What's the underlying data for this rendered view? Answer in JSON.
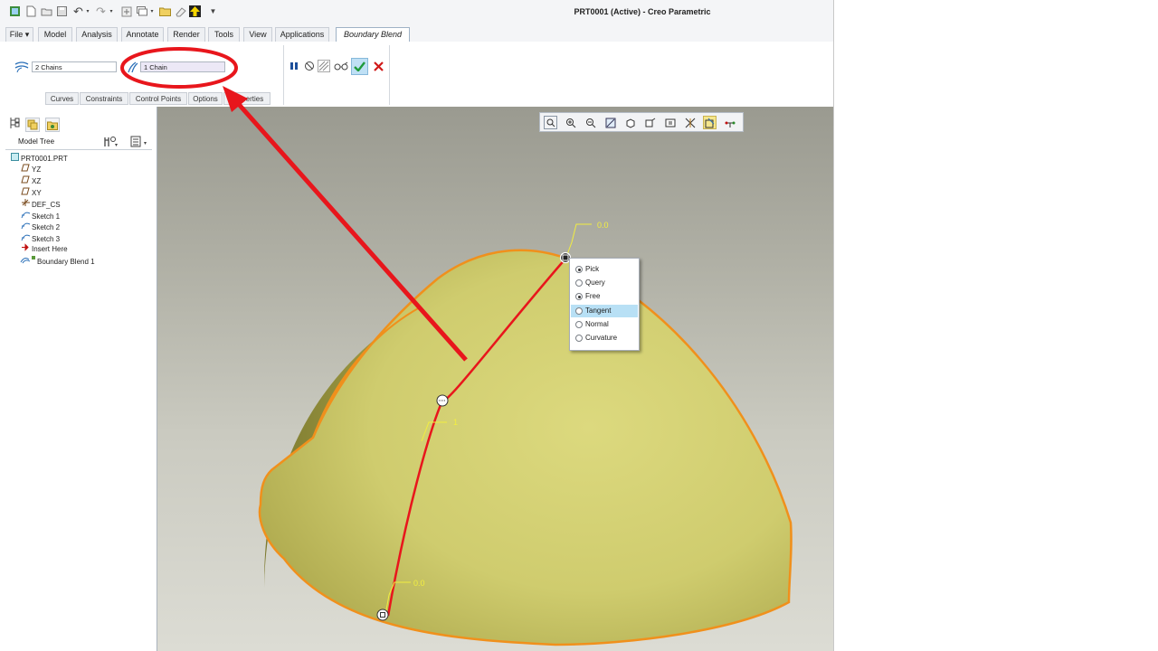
{
  "window": {
    "title": "PRT0001 (Active) - Creo Parametric"
  },
  "quick_access": {
    "icons": [
      "app-icon",
      "new-icon",
      "open-icon",
      "save-icon",
      "undo-icon",
      "undo-dropdown-icon",
      "redo-icon",
      "redo-dropdown-icon",
      "regenerate-icon",
      "windows-icon",
      "windows-dropdown-icon",
      "folder-icon",
      "erase-icon",
      "up-arrow-icon",
      "customize-dropdown-icon"
    ]
  },
  "ribbon": {
    "tabs": [
      {
        "label": "File ▾"
      },
      {
        "label": "Model"
      },
      {
        "label": "Analysis"
      },
      {
        "label": "Annotate"
      },
      {
        "label": "Render"
      },
      {
        "label": "Tools"
      },
      {
        "label": "View"
      },
      {
        "label": "Applications"
      },
      {
        "label": "Boundary Blend",
        "active": true
      }
    ],
    "first_direction_field": "2 Chains",
    "second_direction_field": "1 Chain",
    "subtabs": [
      "Curves",
      "Constraints",
      "Control Points",
      "Options",
      "Properties"
    ],
    "actions": {
      "pause": "pause-icon",
      "no_preview": "no-preview-icon",
      "verify": "verify-icon",
      "glasses": "glasses-icon",
      "ok": "check-icon",
      "cancel": "cancel-icon"
    }
  },
  "model_tree": {
    "header": "Model Tree",
    "items": [
      {
        "label": "PRT0001.PRT",
        "icon": "part-icon",
        "indent": 0
      },
      {
        "label": "YZ",
        "icon": "datum-plane-icon",
        "indent": 1
      },
      {
        "label": "XZ",
        "icon": "datum-plane-icon",
        "indent": 1
      },
      {
        "label": "XY",
        "icon": "datum-plane-icon",
        "indent": 1
      },
      {
        "label": "DEF_CS",
        "icon": "coordinate-system-icon",
        "indent": 1
      },
      {
        "label": "Sketch 1",
        "icon": "sketch-icon",
        "indent": 1
      },
      {
        "label": "Sketch 2",
        "icon": "sketch-icon",
        "indent": 1
      },
      {
        "label": "Sketch 3",
        "icon": "sketch-icon",
        "indent": 1
      },
      {
        "label": "Insert Here",
        "icon": "insert-arrow-icon",
        "indent": 1
      },
      {
        "label": "Boundary Blend 1",
        "icon": "boundary-blend-icon",
        "indent": 1
      }
    ]
  },
  "context_menu": {
    "items": [
      {
        "label": "Pick",
        "checked": true,
        "highlighted": false
      },
      {
        "label": "Query",
        "checked": false,
        "highlighted": false
      },
      {
        "label": "Free",
        "checked": true,
        "highlighted": false
      },
      {
        "label": "Tangent",
        "checked": false,
        "highlighted": true
      },
      {
        "label": "Normal",
        "checked": false,
        "highlighted": false
      },
      {
        "label": "Curvature",
        "checked": false,
        "highlighted": false
      }
    ]
  },
  "viewport": {
    "top_dim": "0.0",
    "mid_dim": "1",
    "bottom_dim": "0.0",
    "colors": {
      "surface": "#c8c56a",
      "edge": "#f0901c",
      "curve": "#e8161c",
      "annotation": "#e8161c",
      "dimension": "#f2ee40"
    }
  },
  "colors": {
    "background": "#f4f5f7",
    "accent": "#2a5fae"
  }
}
